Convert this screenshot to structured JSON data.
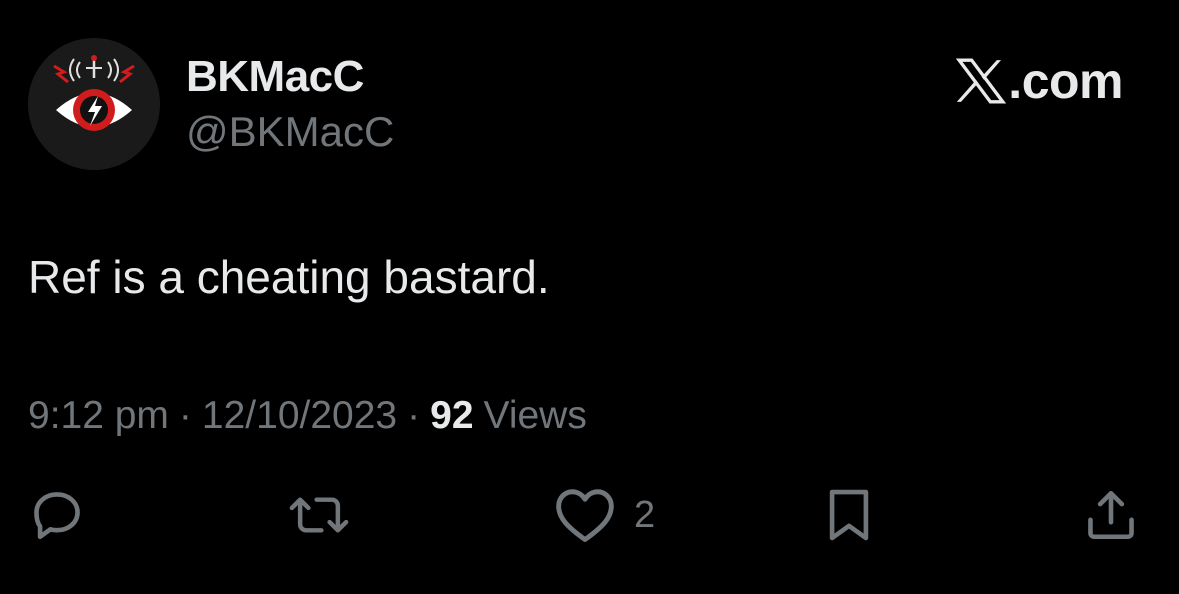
{
  "author": {
    "display_name": "BKMacC",
    "handle": "@BKMacC"
  },
  "brand": {
    "logo_icon": "x-logo-icon",
    "logo_text": ".com"
  },
  "tweet": {
    "text": "Ref is a cheating bastard."
  },
  "meta": {
    "time": "9:12 pm",
    "separator": "·",
    "date": "12/10/2023",
    "views_count": "92",
    "views_label": "Views"
  },
  "actions": {
    "reply_icon": "reply-icon",
    "retweet_icon": "retweet-icon",
    "like_icon": "heart-icon",
    "like_count": "2",
    "bookmark_icon": "bookmark-icon",
    "share_icon": "share-icon"
  },
  "colors": {
    "background": "#000000",
    "primary_text": "#e7e9ea",
    "secondary_text": "#71767b",
    "avatar_accent": "#d01c1c"
  }
}
